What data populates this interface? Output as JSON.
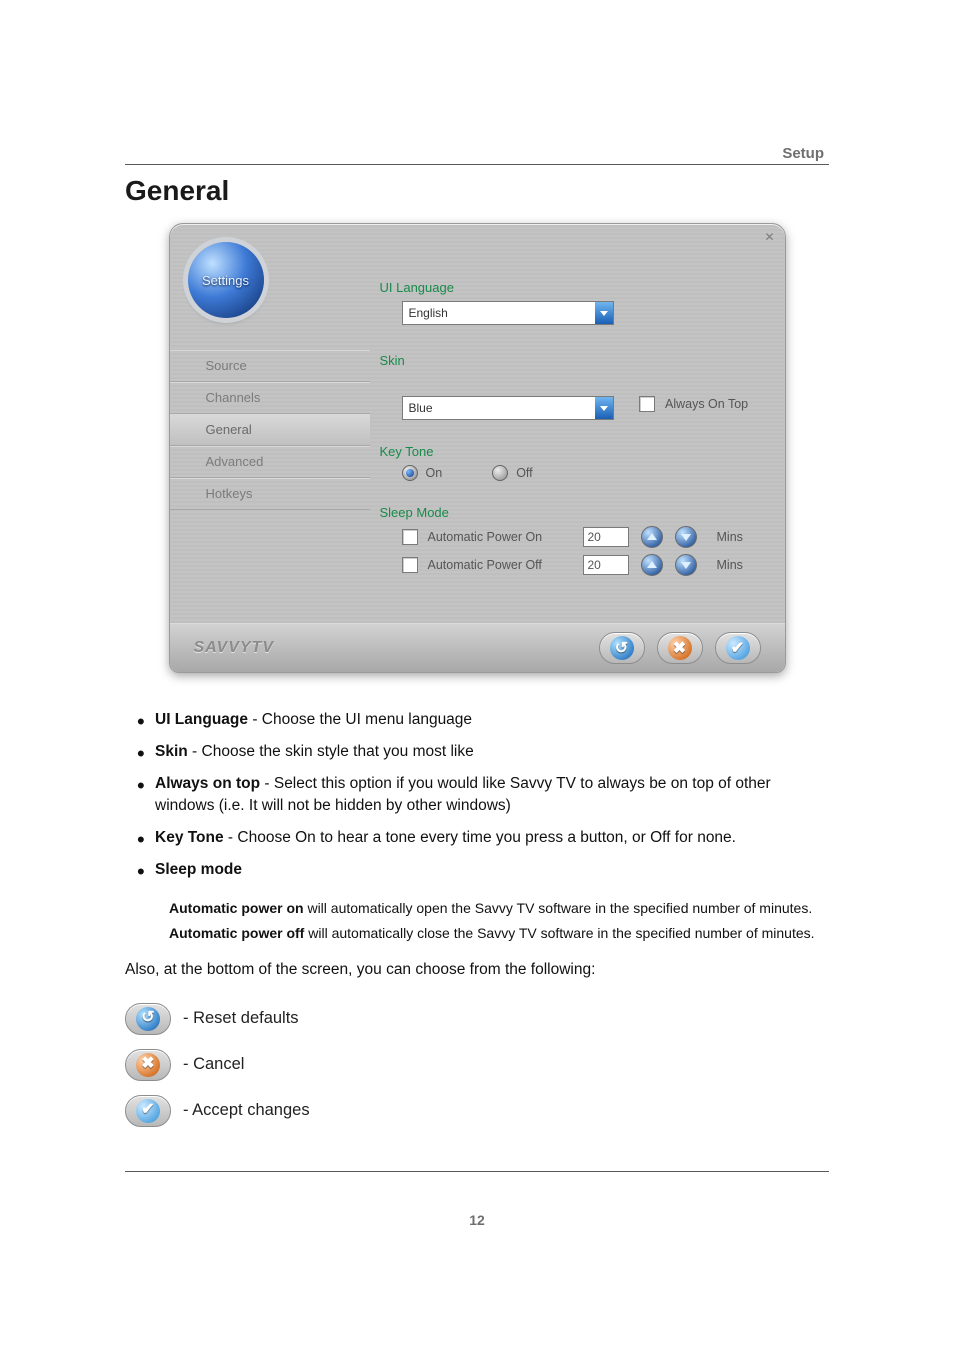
{
  "header": {
    "section": "Setup"
  },
  "title": "General",
  "dialog": {
    "badge_label": "Settings",
    "close_glyph": "✕",
    "brand": "SAVVYTV",
    "sidebar": {
      "items": [
        {
          "label": "Source"
        },
        {
          "label": "Channels"
        },
        {
          "label": "General"
        },
        {
          "label": "Advanced"
        },
        {
          "label": "Hotkeys"
        }
      ],
      "selected_index": 2
    },
    "ui_language": {
      "label": "UI Language",
      "value": "English"
    },
    "skin": {
      "label": "Skin",
      "value": "Blue"
    },
    "always_on_top": {
      "label": "Always On Top",
      "checked": false
    },
    "key_tone": {
      "label": "Key Tone",
      "on_label": "On",
      "off_label": "Off",
      "selected": "On"
    },
    "sleep_mode": {
      "label": "Sleep Mode",
      "rows": [
        {
          "label": "Automatic Power On",
          "value": "20",
          "unit": "Mins",
          "checked": false
        },
        {
          "label": "Automatic Power Off",
          "value": "20",
          "unit": "Mins",
          "checked": false
        }
      ]
    },
    "buttons": {
      "reset_glyph": "↺",
      "cancel_glyph": "✖",
      "ok_glyph": "✔"
    }
  },
  "bullets": {
    "ui_language": {
      "term": "UI Language",
      "desc": " - Choose the UI menu language"
    },
    "skin": {
      "term": "Skin",
      "desc": " - Choose the skin style that you most like"
    },
    "always": {
      "term": "Always on top",
      "desc": " - Select this option if you would like Savvy TV to always be on top of other windows (i.e. It will not be hidden by other windows)"
    },
    "keytone": {
      "term": "Key Tone",
      "desc": " - Choose On to hear a tone every time you press a button, or Off for none."
    },
    "sleep": {
      "term": "Sleep mode"
    },
    "sub1": {
      "term": "Automatic power on",
      "desc": " will automatically open the Savvy TV software in the specified number of minutes."
    },
    "sub2": {
      "term": "Automatic power off",
      "desc": " will automatically close the Savvy TV software in the specified number of minutes."
    }
  },
  "after_text": "Also, at the bottom of the screen, you can choose from the following:",
  "legend": {
    "reset": " - Reset defaults",
    "cancel": " - Cancel",
    "accept": " - Accept changes"
  },
  "page_number": "12"
}
